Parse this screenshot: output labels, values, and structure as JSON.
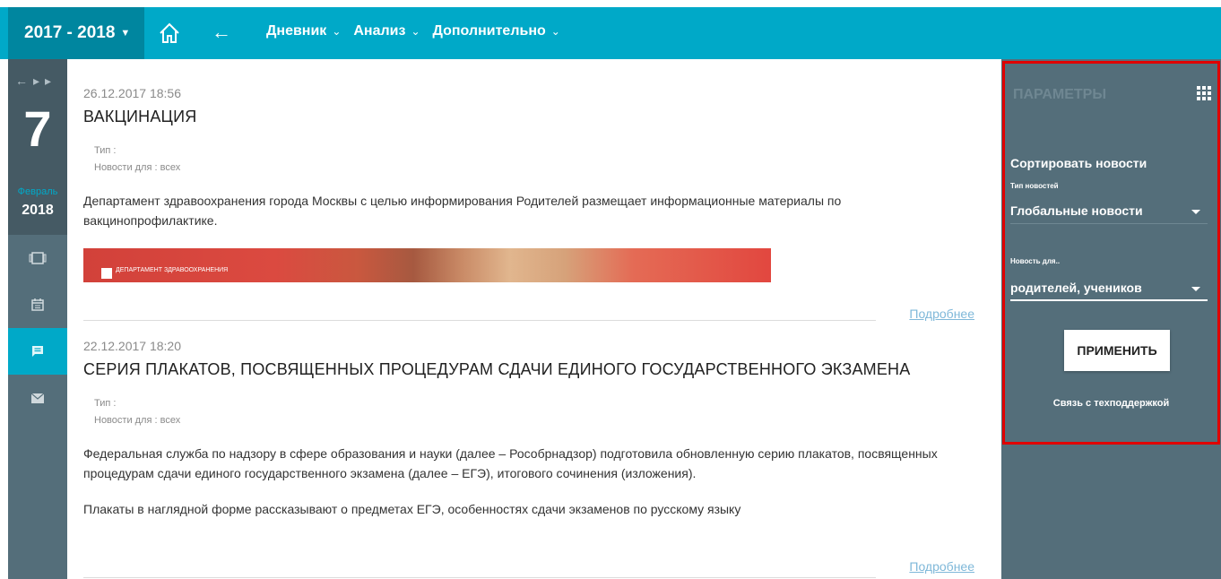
{
  "header": {
    "year_label": "2017 - 2018",
    "menu": [
      {
        "label": "Дневник"
      },
      {
        "label": "Анализ"
      },
      {
        "label": "Дополнительно"
      }
    ]
  },
  "rail": {
    "day": "7",
    "month": "Февраль",
    "year": "2018",
    "nav_icons": [
      "tablet-icon",
      "calendar-icon",
      "news-icon",
      "mail-icon"
    ],
    "active_item": "news-icon"
  },
  "news": [
    {
      "datetime": "26.12.2017 18:56",
      "title": "ВАКЦИНАЦИЯ",
      "type_label": "Тип :",
      "for_label": "Новости для :",
      "for_value": "всех",
      "body": "Департамент здравоохранения города Москвы с целью информирования Родителей размещает информационные материалы по вакцинопрофилактике.",
      "image_logo_text": "ДЕПАРТАМЕНТ ЗДРАВООХРАНЕНИЯ",
      "more": "Подробнее"
    },
    {
      "datetime": "22.12.2017 18:20",
      "title": "СЕРИЯ ПЛАКАТОВ, ПОСВЯЩЕННЫХ ПРОЦЕДУРАМ СДАЧИ ЕДИНОГО ГОСУДАРСТВЕННОГО ЭКЗАМЕНА",
      "type_label": "Тип :",
      "for_label": "Новости для :",
      "for_value": "всех",
      "body": "Федеральная служба по надзору в сфере образования и науки (далее – Рособрнадзор) подготовила обновленную серию плакатов, посвященных процедурам сдачи единого государственного экзамена (далее – ЕГЭ), итогового сочинения (изложения).",
      "body2": "Плакаты в наглядной форме рассказывают о предметах ЕГЭ, особенностях сдачи экзаменов по русскому языку",
      "more": "Подробнее"
    }
  ],
  "panel": {
    "title": "ПАРАМЕТРЫ",
    "sort_title": "Сортировать новости",
    "type_label": "Тип новостей",
    "type_value": "Глобальные новости",
    "for_label": "Новость для..",
    "for_value": "родителей, учеников",
    "apply": "ПРИМЕНИТЬ",
    "support": "Связь с техподдержкой"
  },
  "colors": {
    "topbar": "#00a9c8",
    "year_block": "#00869f",
    "rail": "#546e7a",
    "panel": "#546e7a",
    "highlight_border": "#e00000"
  }
}
